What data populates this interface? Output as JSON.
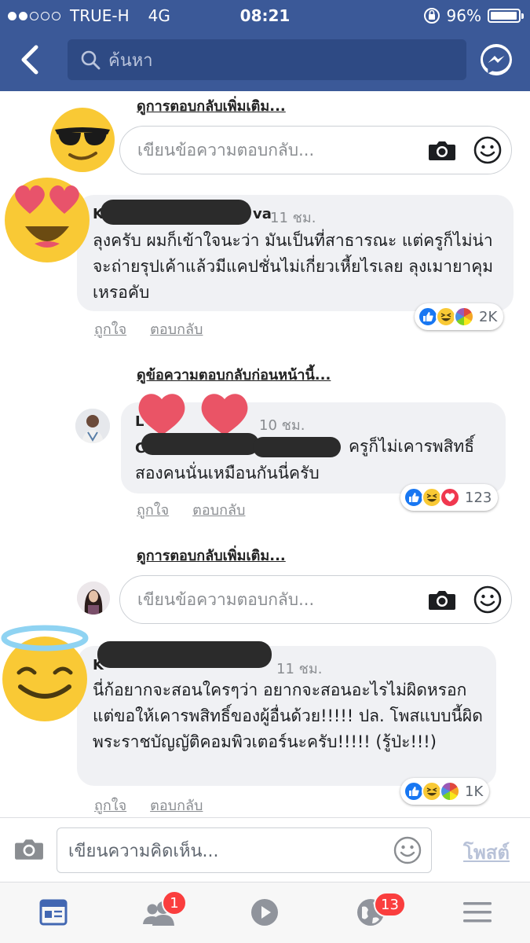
{
  "status_bar": {
    "carrier": "TRUE-H",
    "network": "4G",
    "time": "08:21",
    "battery": "96%",
    "signal_bars_filled": 2,
    "battery_level": 0.96
  },
  "header": {
    "search_placeholder": "ค้นหา",
    "back_icon": "chevron-left-icon",
    "messenger_icon": "messenger-icon"
  },
  "thread": {
    "more_replies_top": "ดูการตอบกลับเพิ่มเติม...",
    "reply_placeholder_1": "เขียนข้อความตอบกลับ...",
    "comment1": {
      "name_visible_start": "K",
      "name_visible_end": "va",
      "time": "11 ชม.",
      "text": "ลุงครับ ผมก็เข้าใจนะว่า มันเป็นที่สาธารณะ แต่ครูก็ไม่น่าจะถ่ายรุปเค้าแล้วมีแคปชั่นไม่เกี่ยวเหี้ยไรเลย ลุงเมายาคุมเหรอคับ",
      "like_label": "ถูกใจ",
      "reply_label": "ตอบกลับ",
      "reaction_count": "2K"
    },
    "previous_replies": "ดูข้อความตอบกลับก่อนหน้านี้...",
    "reply1": {
      "name_visible": "L",
      "time": "10 ชม.",
      "mention_visible": "C",
      "text_after_mention": "ครูก็ไม่เคารพสิทธิ์",
      "text_line2": "สองคนนั่นเหมือนกันนี่ครับ",
      "like_label": "ถูกใจ",
      "reply_label": "ตอบกลับ",
      "reaction_count": "123"
    },
    "more_replies_mid": "ดูการตอบกลับเพิ่มเติม...",
    "reply_placeholder_2": "เขียนข้อความตอบกลับ...",
    "comment2": {
      "name_visible": "K",
      "time": "11 ชม.",
      "text": "นี่ก้อยากจะสอนใครๆว่า อยากจะสอนอะไรไม่ผิดหรอก แต่ขอให้เคารพสิทธิ์ของผู้อื่นด้วย!!!!! ปล. โพสแบบนี้ผิดพระราชบัญญัติคอมพิวเตอร์นะครับ!!!!! (รู้ป่ะ!!!)",
      "like_label": "ถูกใจ",
      "reply_label": "ตอบกลับ",
      "reaction_count": "1K"
    }
  },
  "composer": {
    "placeholder": "เขียนความคิดเห็น...",
    "post_label": "โพสต์"
  },
  "tabbar": {
    "friends_badge": "1",
    "notifications_badge": "13"
  },
  "colors": {
    "brand": "#3b5998",
    "bubble": "#f0f1f4",
    "like": "#1877f2",
    "badge": "#fa3e3e"
  }
}
